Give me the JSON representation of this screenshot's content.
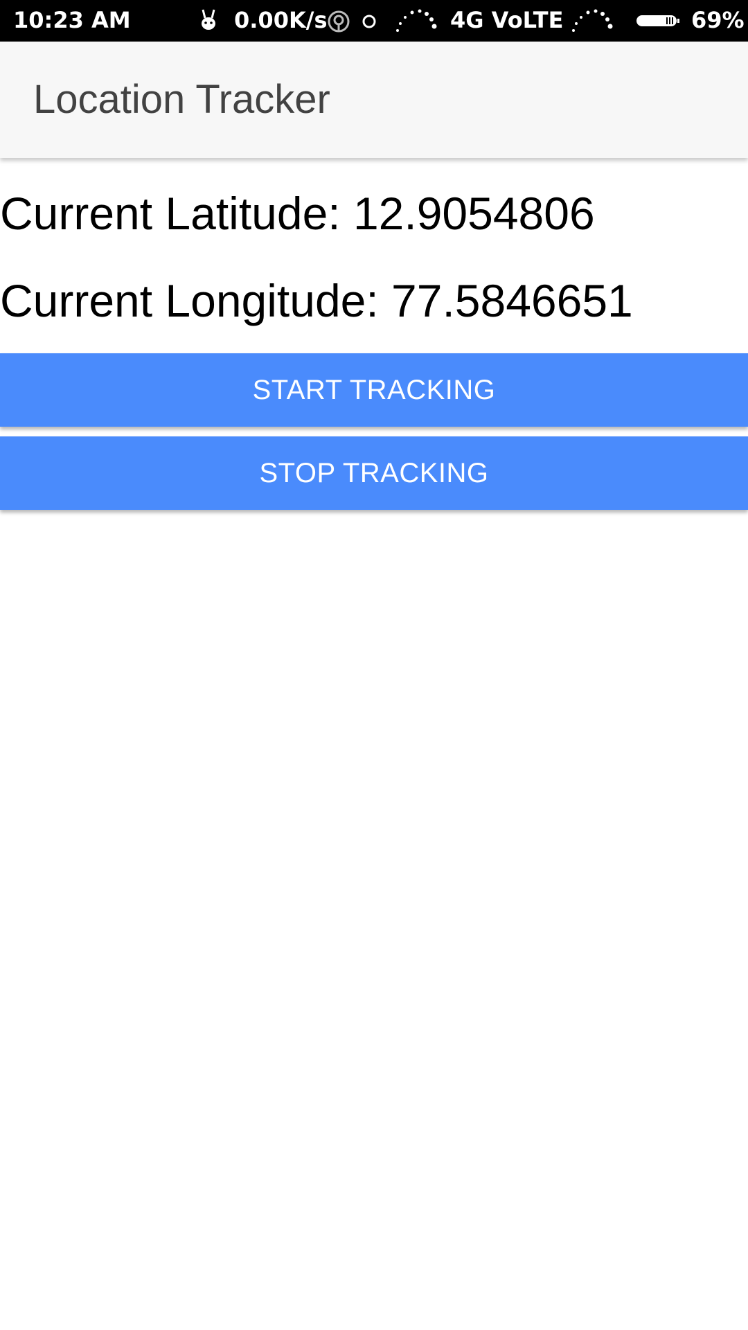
{
  "status_bar": {
    "time": "10:23 AM",
    "speed": "0.00K/s",
    "network": "4G VoLTE",
    "battery": "69%",
    "icons": [
      "bunny-notification-icon",
      "hotspot-icon",
      "circle-notification-icon",
      "signal-icon-1",
      "signal-icon-2",
      "battery-icon"
    ]
  },
  "app_bar": {
    "title": "Location Tracker"
  },
  "location": {
    "latitude_label": "Current Latitude:",
    "latitude_value": "12.9054806",
    "longitude_label": "Current Longitude:",
    "longitude_value": "77.5846651"
  },
  "buttons": {
    "start_label": "START TRACKING",
    "stop_label": "STOP TRACKING"
  },
  "colors": {
    "button_bg": "#4a8bfc",
    "app_bar_bg": "#f7f7f7",
    "status_bar_bg": "#000000"
  }
}
